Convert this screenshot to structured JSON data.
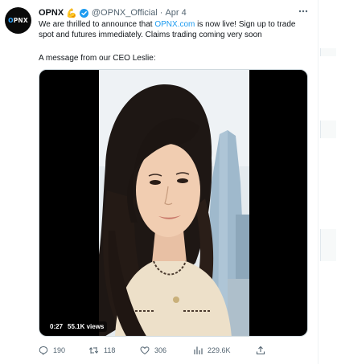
{
  "tweet": {
    "author_name": "OPNX",
    "emoji": "💪",
    "handle": "@OPNX_Official",
    "separator": "·",
    "date": "Apr 4",
    "more_icon": "more-dots-icon",
    "avatar_logo": {
      "part1": "O",
      "part2": "PNX"
    },
    "body": {
      "part1": "We are thrilled to announce that ",
      "link": "OPNX.com",
      "part2": " is now live! Sign up to trade",
      "line2": "spot and futures immediately. Claims trading coming very soon"
    },
    "ceo_line": "A message from our CEO Leslie:",
    "video": {
      "elapsed": "0:27",
      "views": "55.1K views"
    },
    "actions": {
      "replies": "190",
      "retweets": "118",
      "likes": "306",
      "views": "229.6K"
    }
  },
  "colors": {
    "link": "#1d9bf0",
    "verified": "#1d9bf0",
    "secondary_text": "#536471",
    "primary_text": "#0f1419"
  }
}
